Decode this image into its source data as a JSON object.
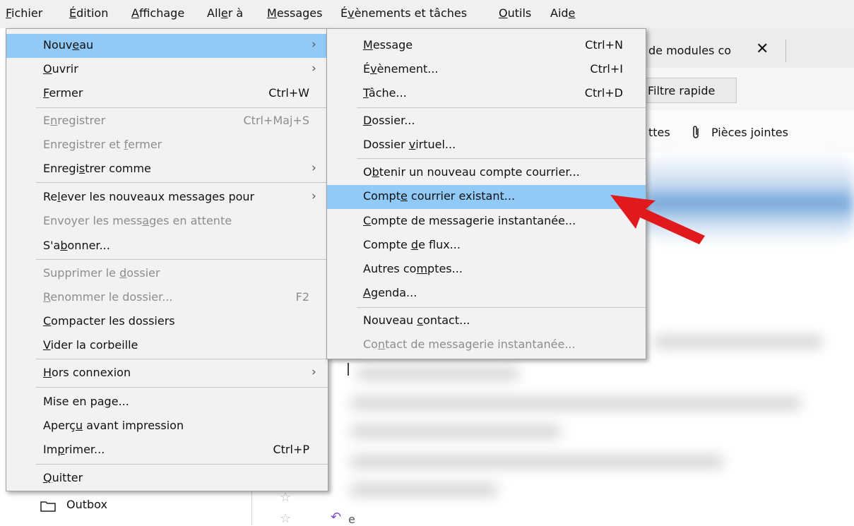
{
  "menubar": {
    "items": [
      {
        "before": "",
        "key": "F",
        "after": "ichier"
      },
      {
        "before": "",
        "key": "É",
        "after": "dition"
      },
      {
        "before": "",
        "key": "A",
        "after": "ffichage"
      },
      {
        "before": "All",
        "key": "e",
        "after": "r à"
      },
      {
        "before": "",
        "key": "M",
        "after": "essages"
      },
      {
        "before": "É",
        "key": "v",
        "after": "ènements et tâches"
      },
      {
        "before": "",
        "key": "O",
        "after": "utils"
      },
      {
        "before": "Aid",
        "key": "e",
        "after": ""
      }
    ]
  },
  "fichier_menu": {
    "items": [
      {
        "before": "Nouv",
        "key": "e",
        "after": "au",
        "shortcut": "",
        "arrow": "›"
      },
      {
        "before": "",
        "key": "O",
        "after": "uvrir",
        "shortcut": "",
        "arrow": "›"
      },
      {
        "before": "",
        "key": "F",
        "after": "ermer",
        "shortcut": "Ctrl+W",
        "arrow": ""
      },
      {
        "before": "E",
        "key": "n",
        "after": "registrer",
        "shortcut": "Ctrl+Maj+S",
        "arrow": ""
      },
      {
        "before": "Enregistrer et ",
        "key": "f",
        "after": "ermer",
        "shortcut": "",
        "arrow": ""
      },
      {
        "before": "Enregi",
        "key": "s",
        "after": "trer comme",
        "shortcut": "",
        "arrow": "›"
      },
      {
        "before": "Re",
        "key": "l",
        "after": "ever les nouveaux messages pour",
        "shortcut": "",
        "arrow": "›"
      },
      {
        "before": "Envoyer les mess",
        "key": "a",
        "after": "ges en attente",
        "shortcut": "",
        "arrow": ""
      },
      {
        "before": "S'a",
        "key": "b",
        "after": "onner...",
        "shortcut": "",
        "arrow": ""
      },
      {
        "before": "Supprimer le ",
        "key": "d",
        "after": "ossier",
        "shortcut": "",
        "arrow": ""
      },
      {
        "before": "",
        "key": "R",
        "after": "enommer le dossier...",
        "shortcut": "F2",
        "arrow": ""
      },
      {
        "before": "",
        "key": "C",
        "after": "ompacter les dossiers",
        "shortcut": "",
        "arrow": ""
      },
      {
        "before": "",
        "key": "V",
        "after": "ider la corbeille",
        "shortcut": "",
        "arrow": ""
      },
      {
        "before": "",
        "key": "H",
        "after": "ors connexion",
        "shortcut": "",
        "arrow": "›"
      },
      {
        "before": "Mise en pa",
        "key": "g",
        "after": "e...",
        "shortcut": "",
        "arrow": ""
      },
      {
        "before": "Aperç",
        "key": "u",
        "after": " avant impression",
        "shortcut": "",
        "arrow": ""
      },
      {
        "before": "Im",
        "key": "p",
        "after": "rimer...",
        "shortcut": "Ctrl+P",
        "arrow": ""
      },
      {
        "before": "",
        "key": "Q",
        "after": "uitter",
        "shortcut": "",
        "arrow": ""
      }
    ]
  },
  "nouveau_menu": {
    "items": [
      {
        "before": "",
        "key": "M",
        "after": "essage",
        "shortcut": "Ctrl+N"
      },
      {
        "before": "É",
        "key": "v",
        "after": "ènement...",
        "shortcut": "Ctrl+I"
      },
      {
        "before": "",
        "key": "T",
        "after": "âche...",
        "shortcut": "Ctrl+D"
      },
      {
        "before": "",
        "key": "D",
        "after": "ossier...",
        "shortcut": ""
      },
      {
        "before": "Dossier ",
        "key": "v",
        "after": "irtuel...",
        "shortcut": ""
      },
      {
        "before": "O",
        "key": "b",
        "after": "tenir un nouveau compte courrier...",
        "shortcut": ""
      },
      {
        "before": "Compt",
        "key": "e",
        "after": " courrier existant...",
        "shortcut": ""
      },
      {
        "before": "",
        "key": "C",
        "after": "ompte de messagerie instantanée...",
        "shortcut": ""
      },
      {
        "before": "Compte ",
        "key": "d",
        "after": "e flux...",
        "shortcut": ""
      },
      {
        "before": "Autres co",
        "key": "m",
        "after": "ptes...",
        "shortcut": ""
      },
      {
        "before": "",
        "key": "A",
        "after": "genda...",
        "shortcut": ""
      },
      {
        "before": "Nouveau ",
        "key": "c",
        "after": "ontact...",
        "shortcut": ""
      },
      {
        "before": "Co",
        "key": "n",
        "after": "tact de messagerie instantanée...",
        "shortcut": ""
      }
    ]
  },
  "background": {
    "tab_label_main": "de modules co",
    "tab_label_fade": "co",
    "tab_close": "✕",
    "quick_filter": "Filtre rapide",
    "filter_tail": "ttes",
    "attachments": "Pièces jointes",
    "outbox": "Outbox",
    "message_stub": "e"
  },
  "colors": {
    "menu_highlight": "#91c9f7",
    "menu_bg": "#f2f2f2",
    "annotation_arrow": "#e0191c"
  }
}
